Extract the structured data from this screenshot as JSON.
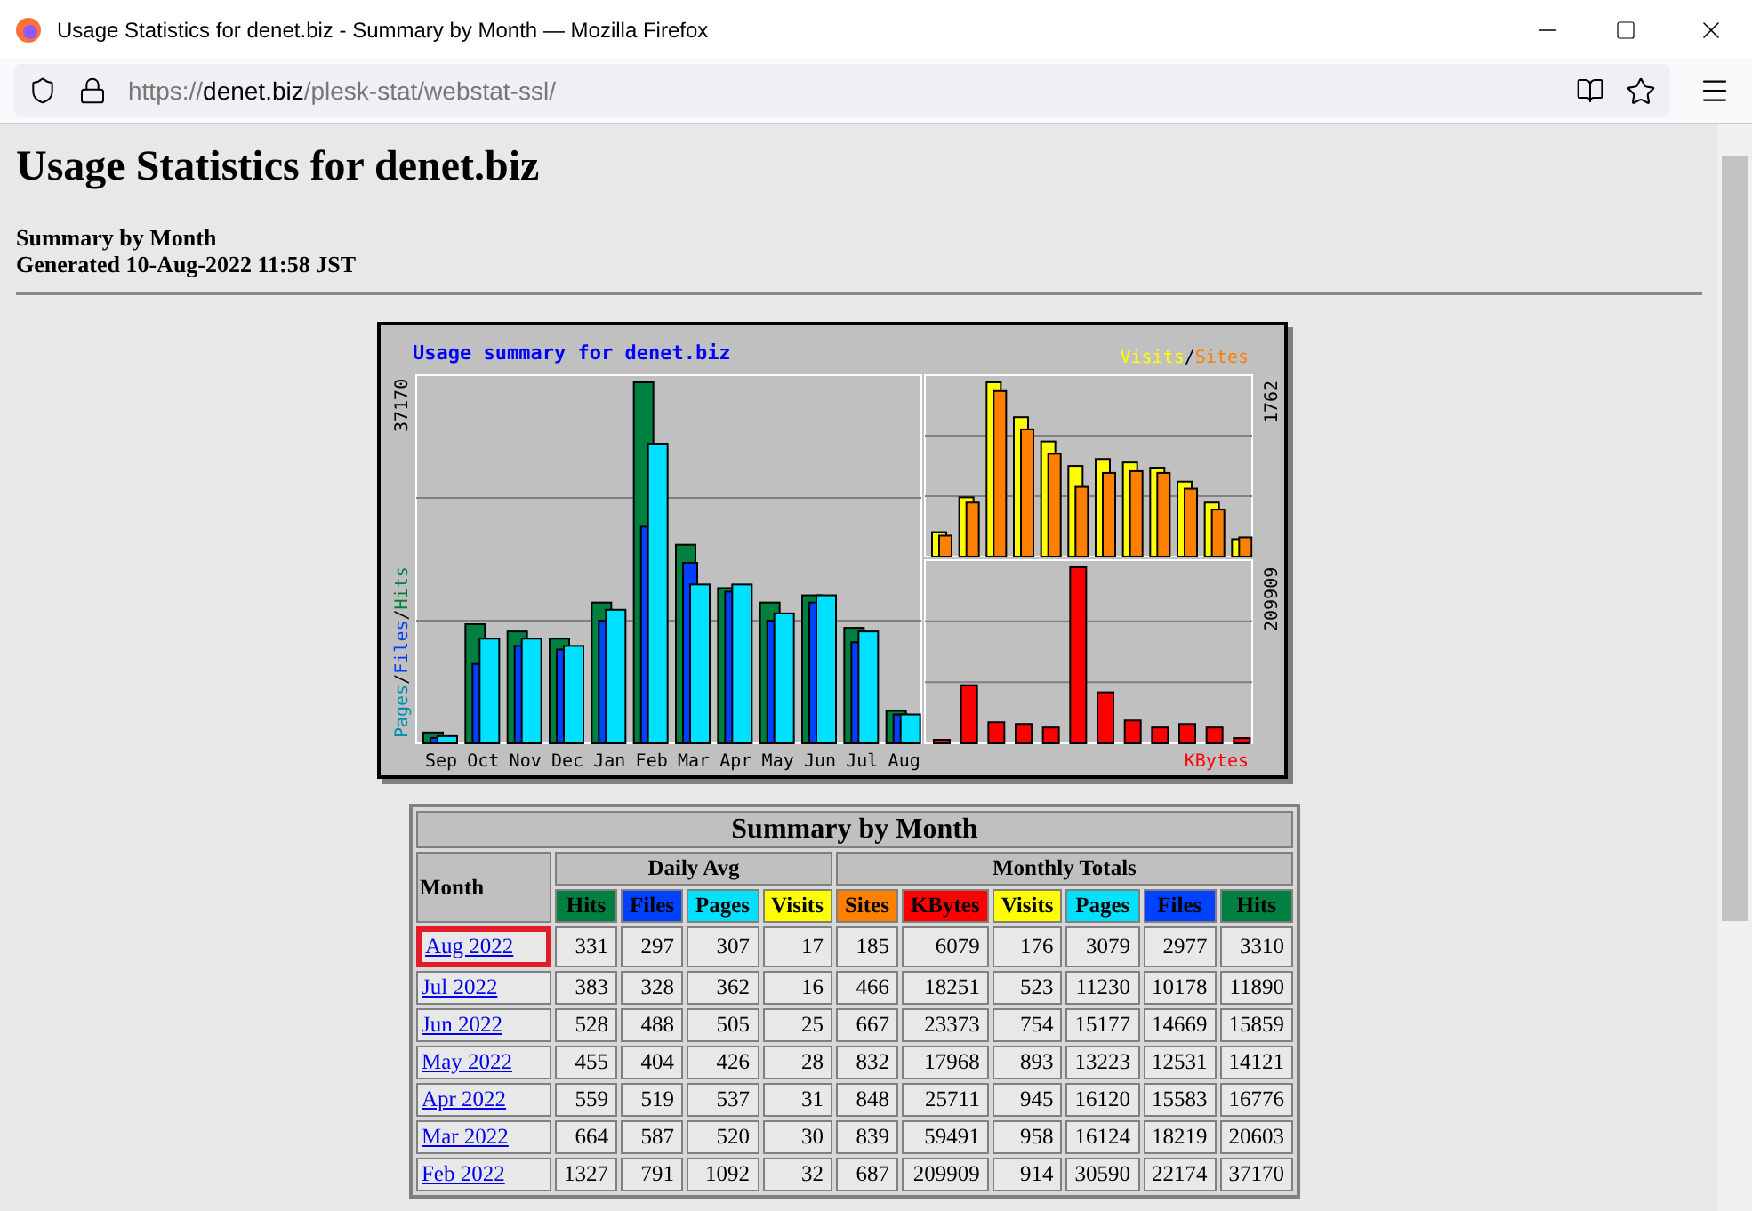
{
  "window": {
    "title": "Usage Statistics for denet.biz - Summary by Month — Mozilla Firefox"
  },
  "address_bar": {
    "prefix": "https://",
    "domain": "denet.biz",
    "path": "/plesk-stat/webstat-ssl/"
  },
  "page": {
    "heading": "Usage Statistics for denet.biz",
    "subtitle": "Summary by Month",
    "generated": "Generated 10-Aug-2022 11:58 JST"
  },
  "usage_chart": {
    "title": "Usage summary for denet.biz",
    "left_max": "37170",
    "left_legend": [
      {
        "label": "Pages",
        "color": "#0090b0"
      },
      {
        "label": "Files",
        "color": "#0040ff"
      },
      {
        "label": "Hits",
        "color": "#008040"
      }
    ],
    "separator": "/",
    "right_legend": [
      {
        "label": "Visits",
        "color": "#ffff00"
      },
      {
        "label": "Sites",
        "color": "#ff8000"
      }
    ],
    "visits_max": "1762",
    "kbytes_max": "209909",
    "kbytes_label": "KBytes",
    "months": [
      "Sep",
      "Oct",
      "Nov",
      "Dec",
      "Jan",
      "Feb",
      "Mar",
      "Apr",
      "May",
      "Jun",
      "Jul",
      "Aug"
    ]
  },
  "table": {
    "title": "Summary by Month",
    "month_header": "Month",
    "groups": [
      "Daily Avg",
      "Monthly Totals"
    ],
    "columns": [
      {
        "label": "Hits",
        "color": "#008040"
      },
      {
        "label": "Files",
        "color": "#0040ff"
      },
      {
        "label": "Pages",
        "color": "#00e0ff"
      },
      {
        "label": "Visits",
        "color": "#ffff00"
      },
      {
        "label": "Sites",
        "color": "#ff8000"
      },
      {
        "label": "KBytes",
        "color": "#ff0000"
      },
      {
        "label": "Visits",
        "color": "#ffff00"
      },
      {
        "label": "Pages",
        "color": "#00e0ff"
      },
      {
        "label": "Files",
        "color": "#0040ff"
      },
      {
        "label": "Hits",
        "color": "#008040"
      }
    ],
    "rows": [
      {
        "month": "Aug 2022",
        "highlighted": true,
        "cells": [
          "331",
          "297",
          "307",
          "17",
          "185",
          "6079",
          "176",
          "3079",
          "2977",
          "3310"
        ]
      },
      {
        "month": "Jul 2022",
        "highlighted": false,
        "cells": [
          "383",
          "328",
          "362",
          "16",
          "466",
          "18251",
          "523",
          "11230",
          "10178",
          "11890"
        ]
      },
      {
        "month": "Jun 2022",
        "highlighted": false,
        "cells": [
          "528",
          "488",
          "505",
          "25",
          "667",
          "23373",
          "754",
          "15177",
          "14669",
          "15859"
        ]
      },
      {
        "month": "May 2022",
        "highlighted": false,
        "cells": [
          "455",
          "404",
          "426",
          "28",
          "832",
          "17968",
          "893",
          "13223",
          "12531",
          "14121"
        ]
      },
      {
        "month": "Apr 2022",
        "highlighted": false,
        "cells": [
          "559",
          "519",
          "537",
          "31",
          "848",
          "25711",
          "945",
          "16120",
          "15583",
          "16776"
        ]
      },
      {
        "month": "Mar 2022",
        "highlighted": false,
        "cells": [
          "664",
          "587",
          "520",
          "30",
          "839",
          "59491",
          "958",
          "16124",
          "18219",
          "20603"
        ]
      },
      {
        "month": "Feb 2022",
        "highlighted": false,
        "cells": [
          "1327",
          "791",
          "1092",
          "32",
          "687",
          "209909",
          "914",
          "30590",
          "22174",
          "37170"
        ]
      }
    ]
  }
}
